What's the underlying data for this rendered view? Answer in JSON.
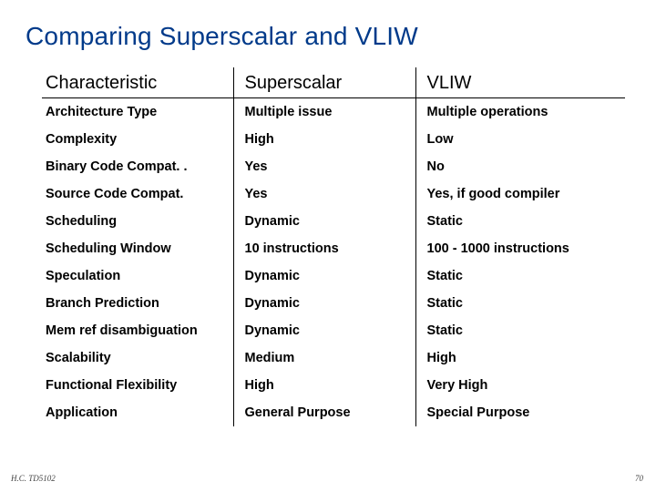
{
  "title": "Comparing Superscalar and VLIW",
  "headers": {
    "c1": "Characteristic",
    "c2": "Superscalar",
    "c3": "VLIW"
  },
  "rows": [
    {
      "c1": "Architecture Type",
      "c2": "Multiple issue",
      "c3": "Multiple operations"
    },
    {
      "c1": "Complexity",
      "c2": "High",
      "c3": "Low"
    },
    {
      "c1": "Binary Code Compat. .",
      "c2": "Yes",
      "c3": "No"
    },
    {
      "c1": "Source Code Compat.",
      "c2": "Yes",
      "c3": "Yes, if good compiler"
    },
    {
      "c1": "Scheduling",
      "c2": "Dynamic",
      "c3": "Static"
    },
    {
      "c1": "Scheduling Window",
      "c2": "10 instructions",
      "c3": "100 - 1000 instructions"
    },
    {
      "c1": "Speculation",
      "c2": "Dynamic",
      "c3": "Static"
    },
    {
      "c1": "Branch Prediction",
      "c2": "Dynamic",
      "c3": "Static"
    },
    {
      "c1": "Mem ref disambiguation",
      "c2": "Dynamic",
      "c3": "Static"
    },
    {
      "c1": "Scalability",
      "c2": "Medium",
      "c3": "High"
    },
    {
      "c1": "Functional Flexibility",
      "c2": "High",
      "c3": "Very High"
    },
    {
      "c1": "Application",
      "c2": "General Purpose",
      "c3": "Special Purpose"
    }
  ],
  "footer": {
    "left": "H.C.  TD5102",
    "right": "70"
  },
  "chart_data": {
    "type": "table",
    "title": "Comparing Superscalar and VLIW",
    "columns": [
      "Characteristic",
      "Superscalar",
      "VLIW"
    ],
    "rows": [
      [
        "Architecture Type",
        "Multiple issue",
        "Multiple operations"
      ],
      [
        "Complexity",
        "High",
        "Low"
      ],
      [
        "Binary Code Compat.",
        "Yes",
        "No"
      ],
      [
        "Source Code Compat.",
        "Yes",
        "Yes, if good compiler"
      ],
      [
        "Scheduling",
        "Dynamic",
        "Static"
      ],
      [
        "Scheduling Window",
        "10 instructions",
        "100 - 1000 instructions"
      ],
      [
        "Speculation",
        "Dynamic",
        "Static"
      ],
      [
        "Branch Prediction",
        "Dynamic",
        "Static"
      ],
      [
        "Mem ref disambiguation",
        "Dynamic",
        "Static"
      ],
      [
        "Scalability",
        "Medium",
        "High"
      ],
      [
        "Functional Flexibility",
        "High",
        "Very High"
      ],
      [
        "Application",
        "General Purpose",
        "Special Purpose"
      ]
    ]
  }
}
